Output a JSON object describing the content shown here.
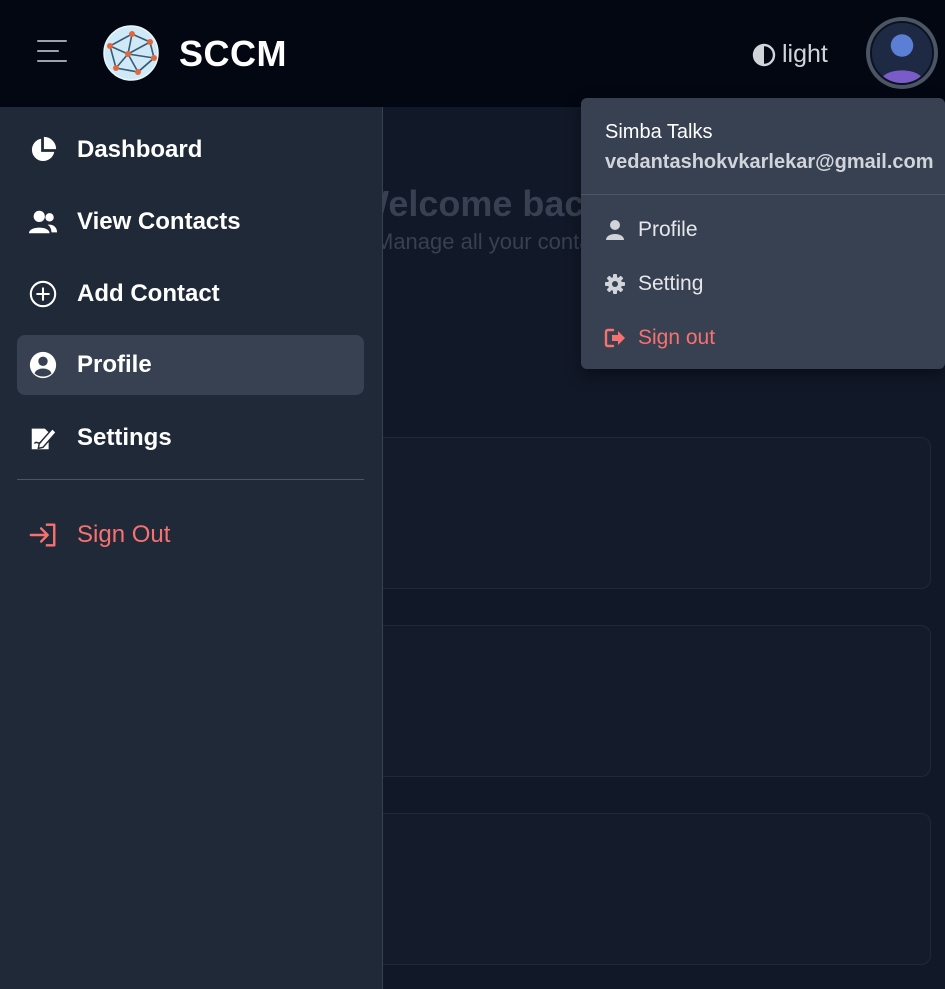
{
  "navbar": {
    "brand": "SCCM",
    "theme_label": "light"
  },
  "page": {
    "welcome_text": "Welcome back, Simba Talks",
    "subtitle": "Manage all your contacts in one place"
  },
  "sidebar": {
    "items": [
      {
        "label": "Dashboard",
        "icon": "chart-pie-icon"
      },
      {
        "label": "View Contacts",
        "icon": "users-icon"
      },
      {
        "label": "Add Contact",
        "icon": "plus-circle-icon"
      },
      {
        "label": "Profile",
        "icon": "user-circle-icon",
        "active": true
      },
      {
        "label": "Settings",
        "icon": "file-signature-icon"
      }
    ],
    "signout_label": "Sign Out"
  },
  "user_menu": {
    "name": "Simba Talks",
    "email": "vedantashokvkarlekar@gmail.com",
    "items": [
      {
        "label": "Profile",
        "icon": "user-icon"
      },
      {
        "label": "Setting",
        "icon": "gear-icon"
      },
      {
        "label": "Sign out",
        "icon": "sign-out-icon"
      }
    ]
  },
  "colors": {
    "navbar_bg": "#030712",
    "sidebar_bg": "#1f2937",
    "active_item_bg": "#374151",
    "danger": "#f87171"
  }
}
